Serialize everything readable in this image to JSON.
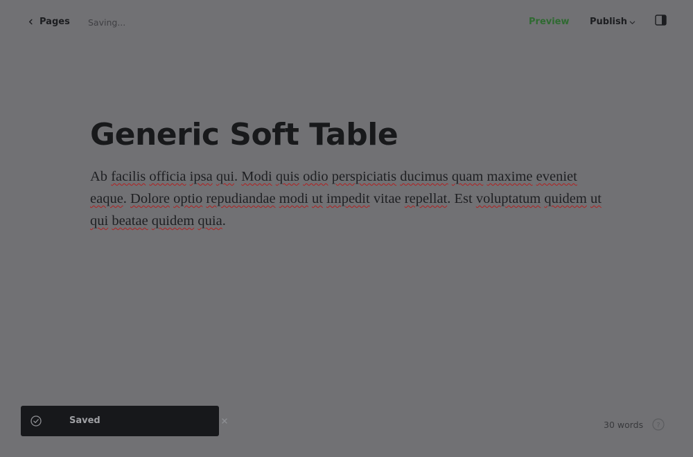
{
  "topbar": {
    "back_label": "Pages",
    "status": "Saving...",
    "preview_label": "Preview",
    "publish_label": "Publish"
  },
  "document": {
    "title": "Generic Soft Table",
    "body_words": [
      {
        "t": "Ab",
        "s": false
      },
      {
        "t": "facilis",
        "s": true
      },
      {
        "t": "officia",
        "s": true
      },
      {
        "t": "ipsa",
        "s": true
      },
      {
        "t": "qui",
        "s": true
      },
      {
        "t": ".",
        "s": false,
        "p": true
      },
      {
        "t": "Modi",
        "s": true
      },
      {
        "t": "quis",
        "s": true
      },
      {
        "t": "odio",
        "s": true
      },
      {
        "t": "perspiciatis",
        "s": true
      },
      {
        "t": "ducimus",
        "s": true
      },
      {
        "t": "quam",
        "s": true
      },
      {
        "t": "maxime",
        "s": true
      },
      {
        "t": "eveniet",
        "s": true
      },
      {
        "t": "eaque",
        "s": true
      },
      {
        "t": ".",
        "s": false,
        "p": true
      },
      {
        "t": "Dolore",
        "s": true
      },
      {
        "t": "optio",
        "s": true
      },
      {
        "t": "repudiandae",
        "s": true
      },
      {
        "t": "modi",
        "s": true
      },
      {
        "t": "ut",
        "s": true
      },
      {
        "t": "impedit",
        "s": true
      },
      {
        "t": "vitae",
        "s": false
      },
      {
        "t": "repellat",
        "s": true
      },
      {
        "t": ".",
        "s": false,
        "p": true
      },
      {
        "t": "Est",
        "s": false
      },
      {
        "t": "voluptatum",
        "s": true
      },
      {
        "t": "quidem",
        "s": true
      },
      {
        "t": "ut",
        "s": true
      },
      {
        "t": "qui",
        "s": true
      },
      {
        "t": "beatae",
        "s": true
      },
      {
        "t": "quidem",
        "s": true
      },
      {
        "t": "quia",
        "s": true
      },
      {
        "t": ".",
        "s": false,
        "p": true
      }
    ]
  },
  "toast": {
    "label": "Saved",
    "icon": "check-circle-icon"
  },
  "footer": {
    "word_count": "30 words",
    "help_icon": "help-icon"
  },
  "colors": {
    "preview_accent": "#2f6a31",
    "spell_underline": "#b21f1f"
  }
}
